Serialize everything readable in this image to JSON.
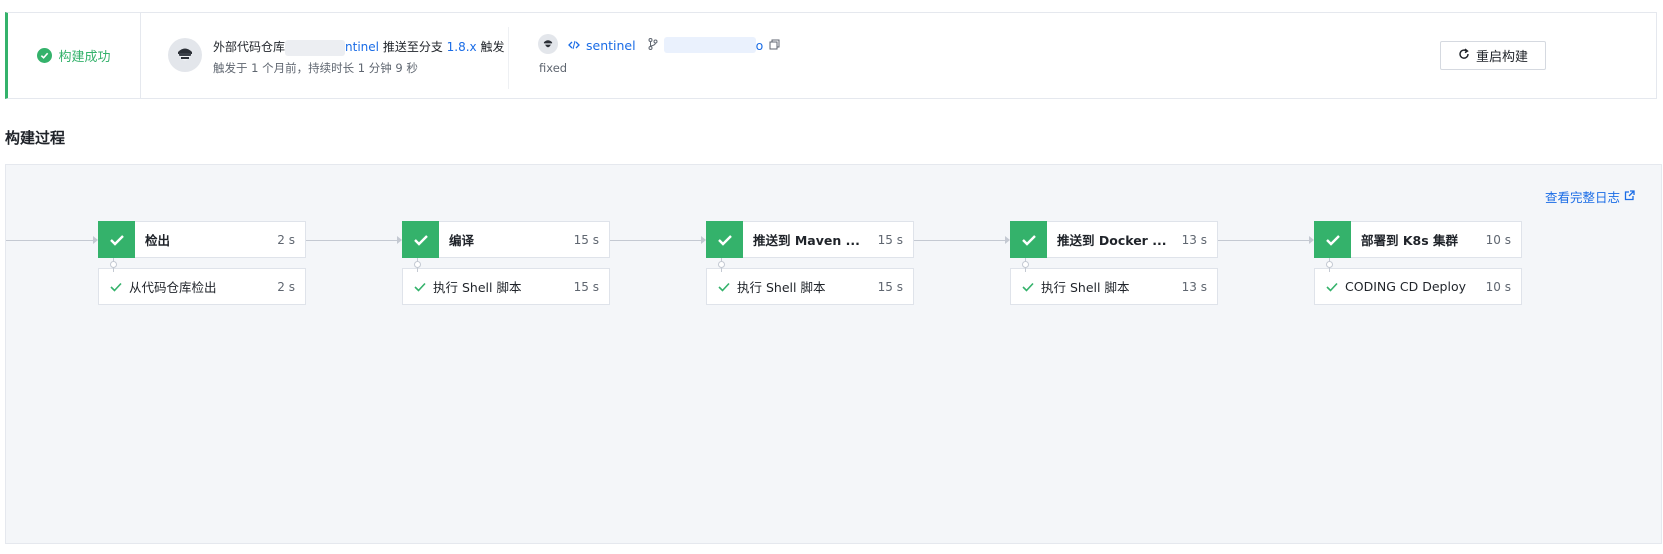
{
  "build": {
    "status_label": "构建成功",
    "commit": {
      "prefix": "外部代码仓库",
      "repo_suffix": "ntinel",
      "push_text": "推送至分支",
      "branch": "1.8.x",
      "trigger_text": "触发",
      "meta": "触发于 1 个月前，持续时长 1 分钟 9 秒"
    },
    "repo": {
      "name": "sentinel",
      "commit_suffix": "o",
      "message": "fixed"
    },
    "restart_label": "重启构建"
  },
  "process": {
    "title": "构建过程",
    "full_log_label": "查看完整日志",
    "stages": [
      {
        "name": "检出",
        "time": "2 s",
        "step_name": "从代码仓库检出",
        "step_time": "2 s"
      },
      {
        "name": "编译",
        "time": "15 s",
        "step_name": "执行 Shell 脚本",
        "step_time": "15 s"
      },
      {
        "name": "推送到 Maven ...",
        "time": "15 s",
        "step_name": "执行 Shell 脚本",
        "step_time": "15 s"
      },
      {
        "name": "推送到 Docker ...",
        "time": "13 s",
        "step_name": "执行 Shell 脚本",
        "step_time": "13 s"
      },
      {
        "name": "部署到 K8s 集群",
        "time": "10 s",
        "step_name": "CODING CD Deploy",
        "step_time": "10 s"
      }
    ]
  },
  "colors": {
    "success": "#34b26b",
    "link": "#1a6ce6"
  },
  "icons": [
    "check-circle-icon",
    "avatar-icon",
    "code-icon",
    "branch-icon",
    "copy-icon",
    "refresh-icon",
    "external-link-icon",
    "check-icon"
  ]
}
